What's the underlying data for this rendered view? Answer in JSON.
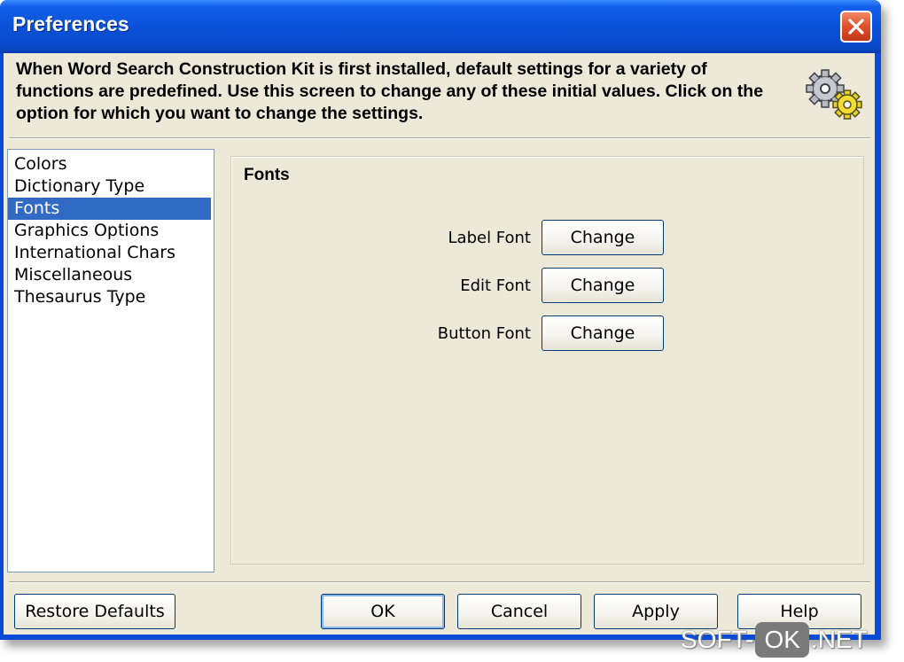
{
  "window": {
    "title": "Preferences",
    "description": "When Word Search Construction Kit is first installed, default settings for a variety of functions are predefined.  Use this screen to change any of these initial values.  Click on the option for which you want to change the settings."
  },
  "icons": {
    "close": "close-icon",
    "settings": "gears-icon"
  },
  "categories": {
    "items": [
      {
        "label": "Colors"
      },
      {
        "label": "Dictionary Type"
      },
      {
        "label": "Fonts"
      },
      {
        "label": "Graphics Options"
      },
      {
        "label": "International Chars"
      },
      {
        "label": "Miscellaneous"
      },
      {
        "label": "Thesaurus Type"
      }
    ],
    "selected": "Fonts"
  },
  "panel": {
    "title": "Fonts",
    "rows": [
      {
        "label": "Label Font",
        "button": "Change"
      },
      {
        "label": "Edit Font",
        "button": "Change"
      },
      {
        "label": "Button Font",
        "button": "Change"
      }
    ]
  },
  "buttons": {
    "restore": "Restore Defaults",
    "ok": "OK",
    "cancel": "Cancel",
    "apply": "Apply",
    "help": "Help"
  },
  "watermark": {
    "left": "SOFT-",
    "middle": "OK",
    "right": ".NET"
  },
  "colors": {
    "titlebar": "#0a52d8",
    "selection": "#316ac5",
    "dialog_bg": "#ece9d8",
    "close_button": "#e0502a"
  }
}
